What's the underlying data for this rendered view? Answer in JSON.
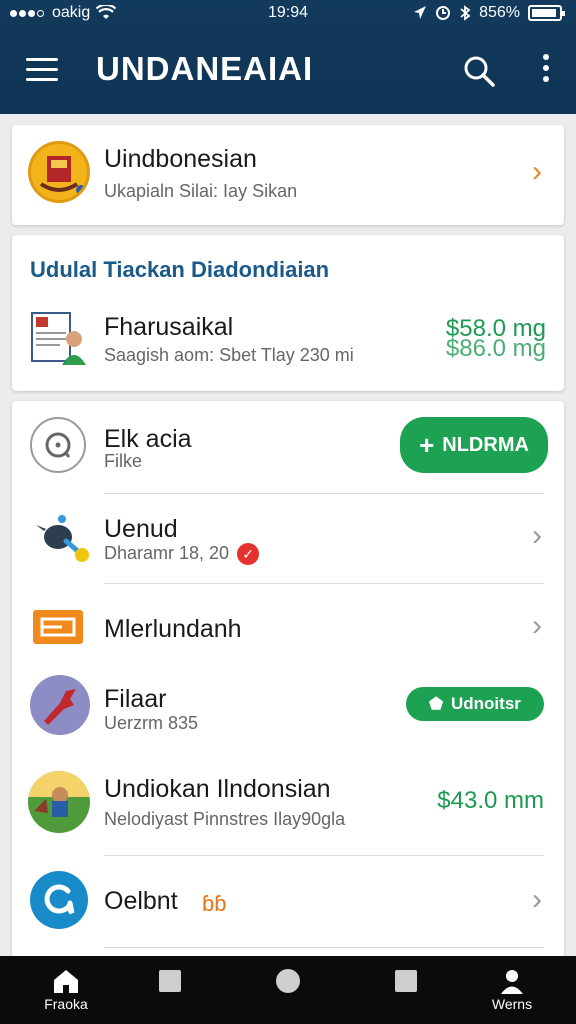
{
  "status_bar": {
    "carrier": "oakig",
    "time": "19:94",
    "battery": "856%"
  },
  "app_bar": {
    "title": "UNDANEAIAI"
  },
  "profile_card": {
    "name": "Uindbonesian",
    "subtitle": "Ukapialn Silai: Iay Sikan"
  },
  "featured_card": {
    "heading": "Udulal Tiackan Diadondiaian",
    "item_title": "Fharusaikal",
    "item_subtitle": "Saagish  aom: Sbet  Tlay 230 mi",
    "price_line1": "$58.0 mg",
    "price_line2": "$86.0 mg"
  },
  "list": {
    "items": [
      {
        "title": "Elk acia",
        "subtitle": "Filke",
        "button_label": "NLDRMA"
      },
      {
        "title": "Uenud",
        "subtitle": "Dharamr 18, 20"
      },
      {
        "title": "Mlerlundanh",
        "subtitle": ""
      },
      {
        "title": "Filaar",
        "subtitle": "Uerzrm 835",
        "button_label": "Udnoitsr"
      },
      {
        "title": "Undiokan Ilndonsian",
        "subtitle": "Nelodiyast Pinnstres Ilay90gla",
        "price": "$43.0 mm"
      },
      {
        "title": "Oelbnt",
        "subtitle": ""
      }
    ]
  },
  "bottom_nav": {
    "items": [
      {
        "label": "Fraoka",
        "icon": "home-icon"
      },
      {
        "label": "",
        "icon": "square-icon"
      },
      {
        "label": "",
        "icon": "circle-icon"
      },
      {
        "label": "",
        "icon": "square-icon"
      },
      {
        "label": "Werns",
        "icon": "person-icon"
      }
    ]
  },
  "colors": {
    "app_bar": "#0f3455",
    "accent_green": "#1da152",
    "heading_blue": "#1a5a8a",
    "badge_red": "#e4322d"
  }
}
